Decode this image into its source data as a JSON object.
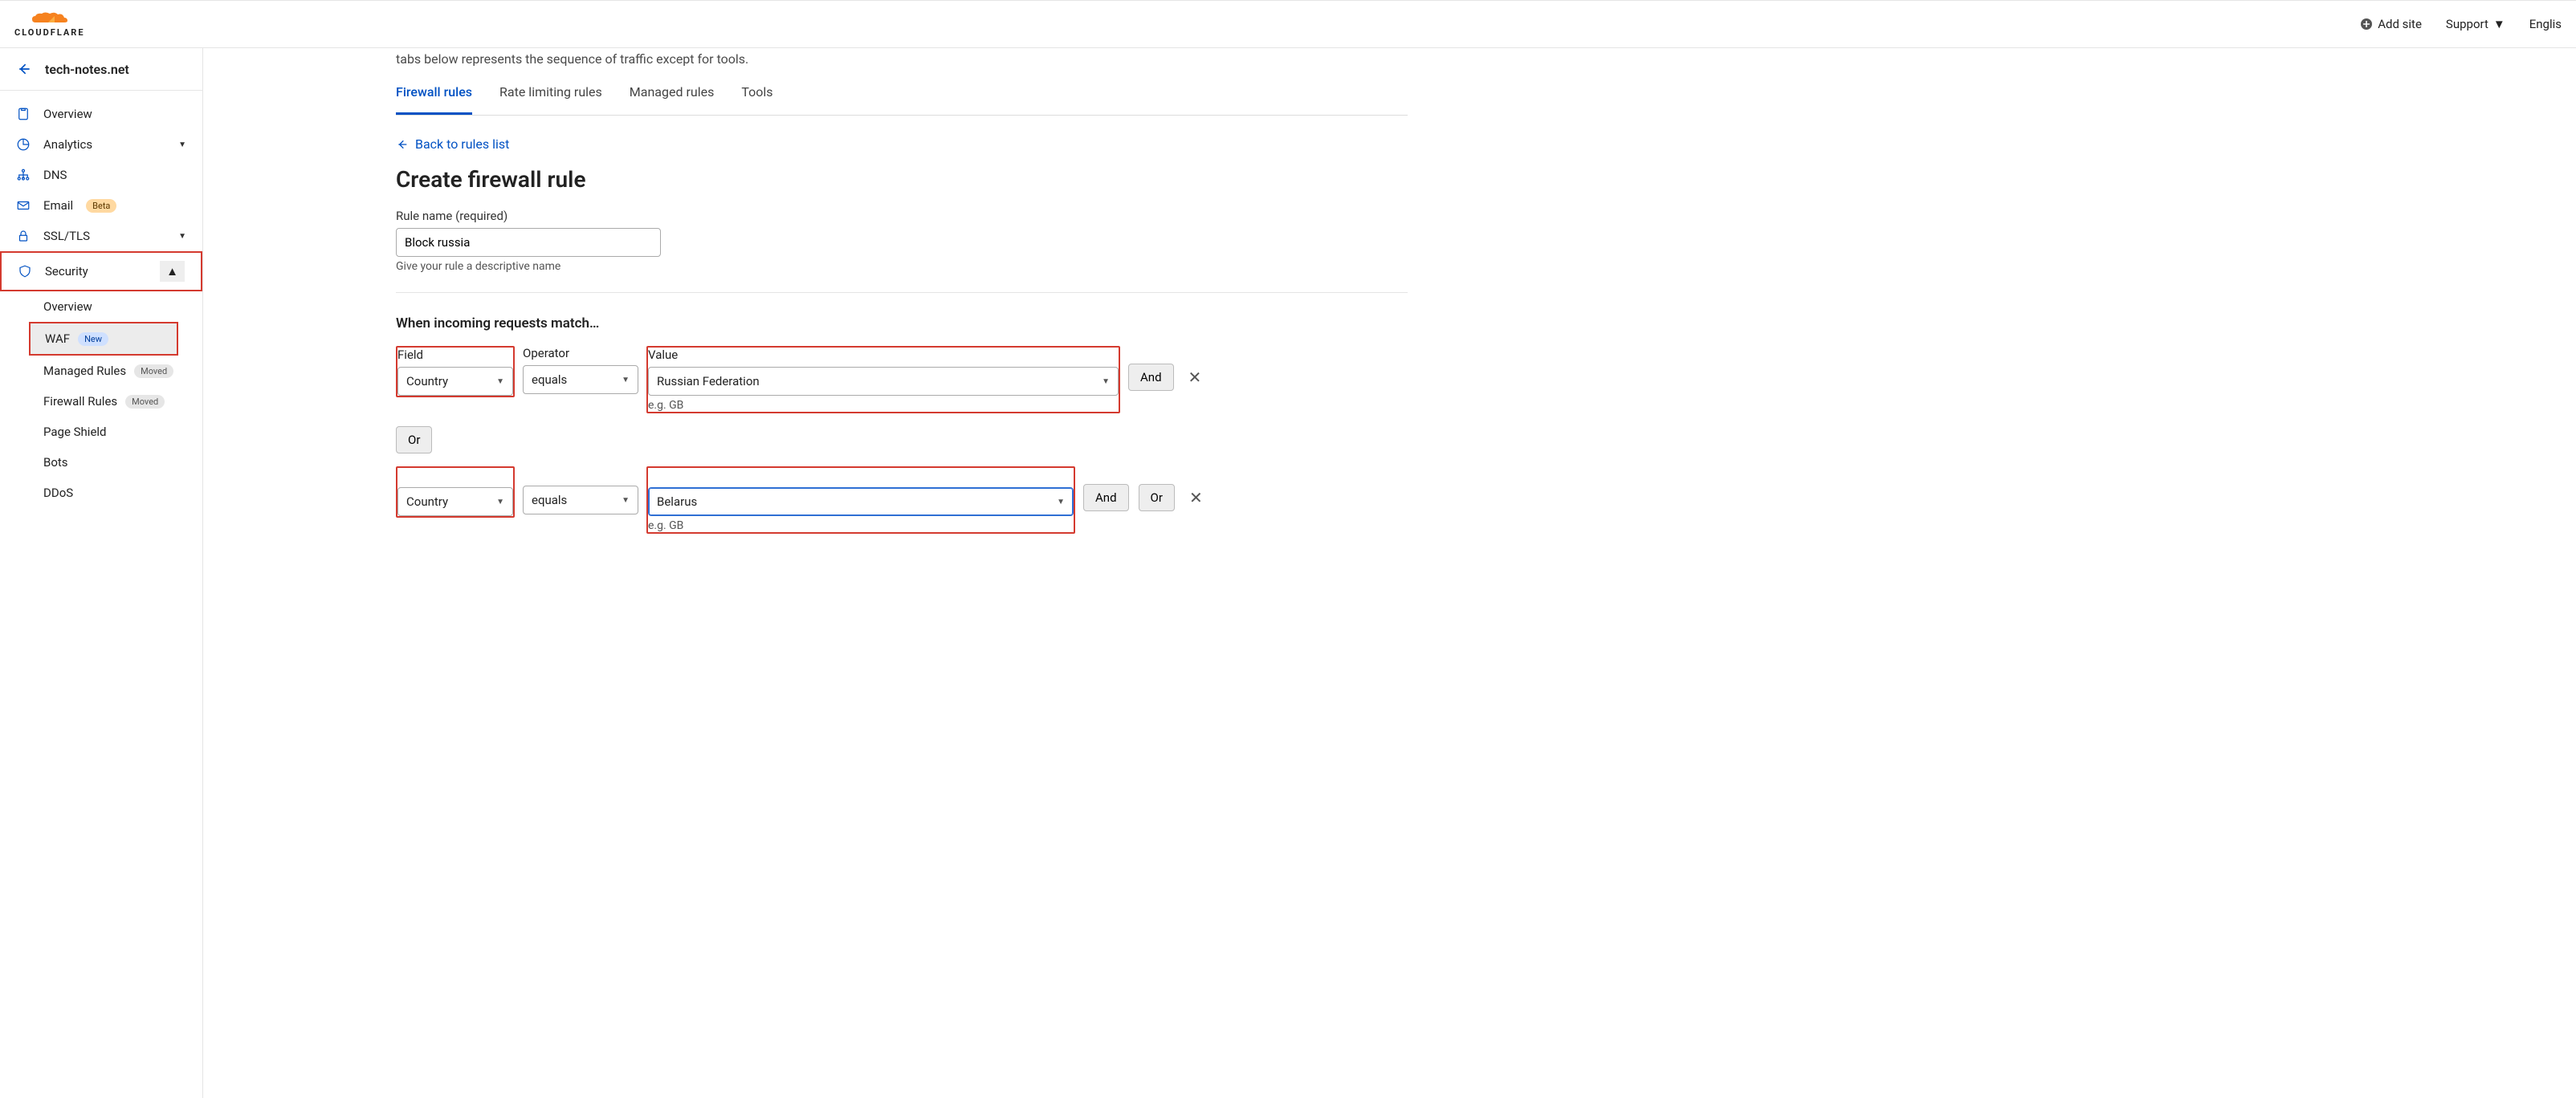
{
  "brand": "CLOUDFLARE",
  "topbar": {
    "add_site": "Add site",
    "support": "Support",
    "language": "Englis"
  },
  "site_name": "tech-notes.net",
  "sidebar": {
    "items": [
      {
        "label": "Overview"
      },
      {
        "label": "Analytics",
        "chevron": true
      },
      {
        "label": "DNS"
      },
      {
        "label": "Email",
        "badge": "Beta",
        "badge_class": "badge-beta"
      },
      {
        "label": "SSL/TLS",
        "chevron": true
      },
      {
        "label": "Security",
        "chevron_up": true,
        "highlight": true
      }
    ],
    "security_sub": [
      {
        "label": "Overview"
      },
      {
        "label": "WAF",
        "badge": "New",
        "badge_class": "badge-new",
        "active": true,
        "highlight": true
      },
      {
        "label": "Managed Rules",
        "badge": "Moved",
        "badge_class": "badge-moved"
      },
      {
        "label": "Firewall Rules",
        "badge": "Moved",
        "badge_class": "badge-moved"
      },
      {
        "label": "Page Shield"
      },
      {
        "label": "Bots"
      },
      {
        "label": "DDoS"
      }
    ]
  },
  "main": {
    "partial_line": "tabs below represents the sequence of traffic except for tools.",
    "tabs": [
      "Firewall rules",
      "Rate limiting rules",
      "Managed rules",
      "Tools"
    ],
    "active_tab": 0,
    "back_link": "Back to rules list",
    "heading": "Create firewall rule",
    "rule_name_label": "Rule name (required)",
    "rule_name_value": "Block russia",
    "rule_name_hint": "Give your rule a descriptive name",
    "match_heading": "When incoming requests match…",
    "col_field": "Field",
    "col_operator": "Operator",
    "col_value": "Value",
    "value_hint": "e.g. GB",
    "or_label": "Or",
    "and_label": "And",
    "conditions": [
      {
        "field": "Country",
        "operator": "equals",
        "value": "Russian Federation"
      },
      {
        "field": "Country",
        "operator": "equals",
        "value": "Belarus",
        "focus": true,
        "show_or": true
      }
    ]
  }
}
